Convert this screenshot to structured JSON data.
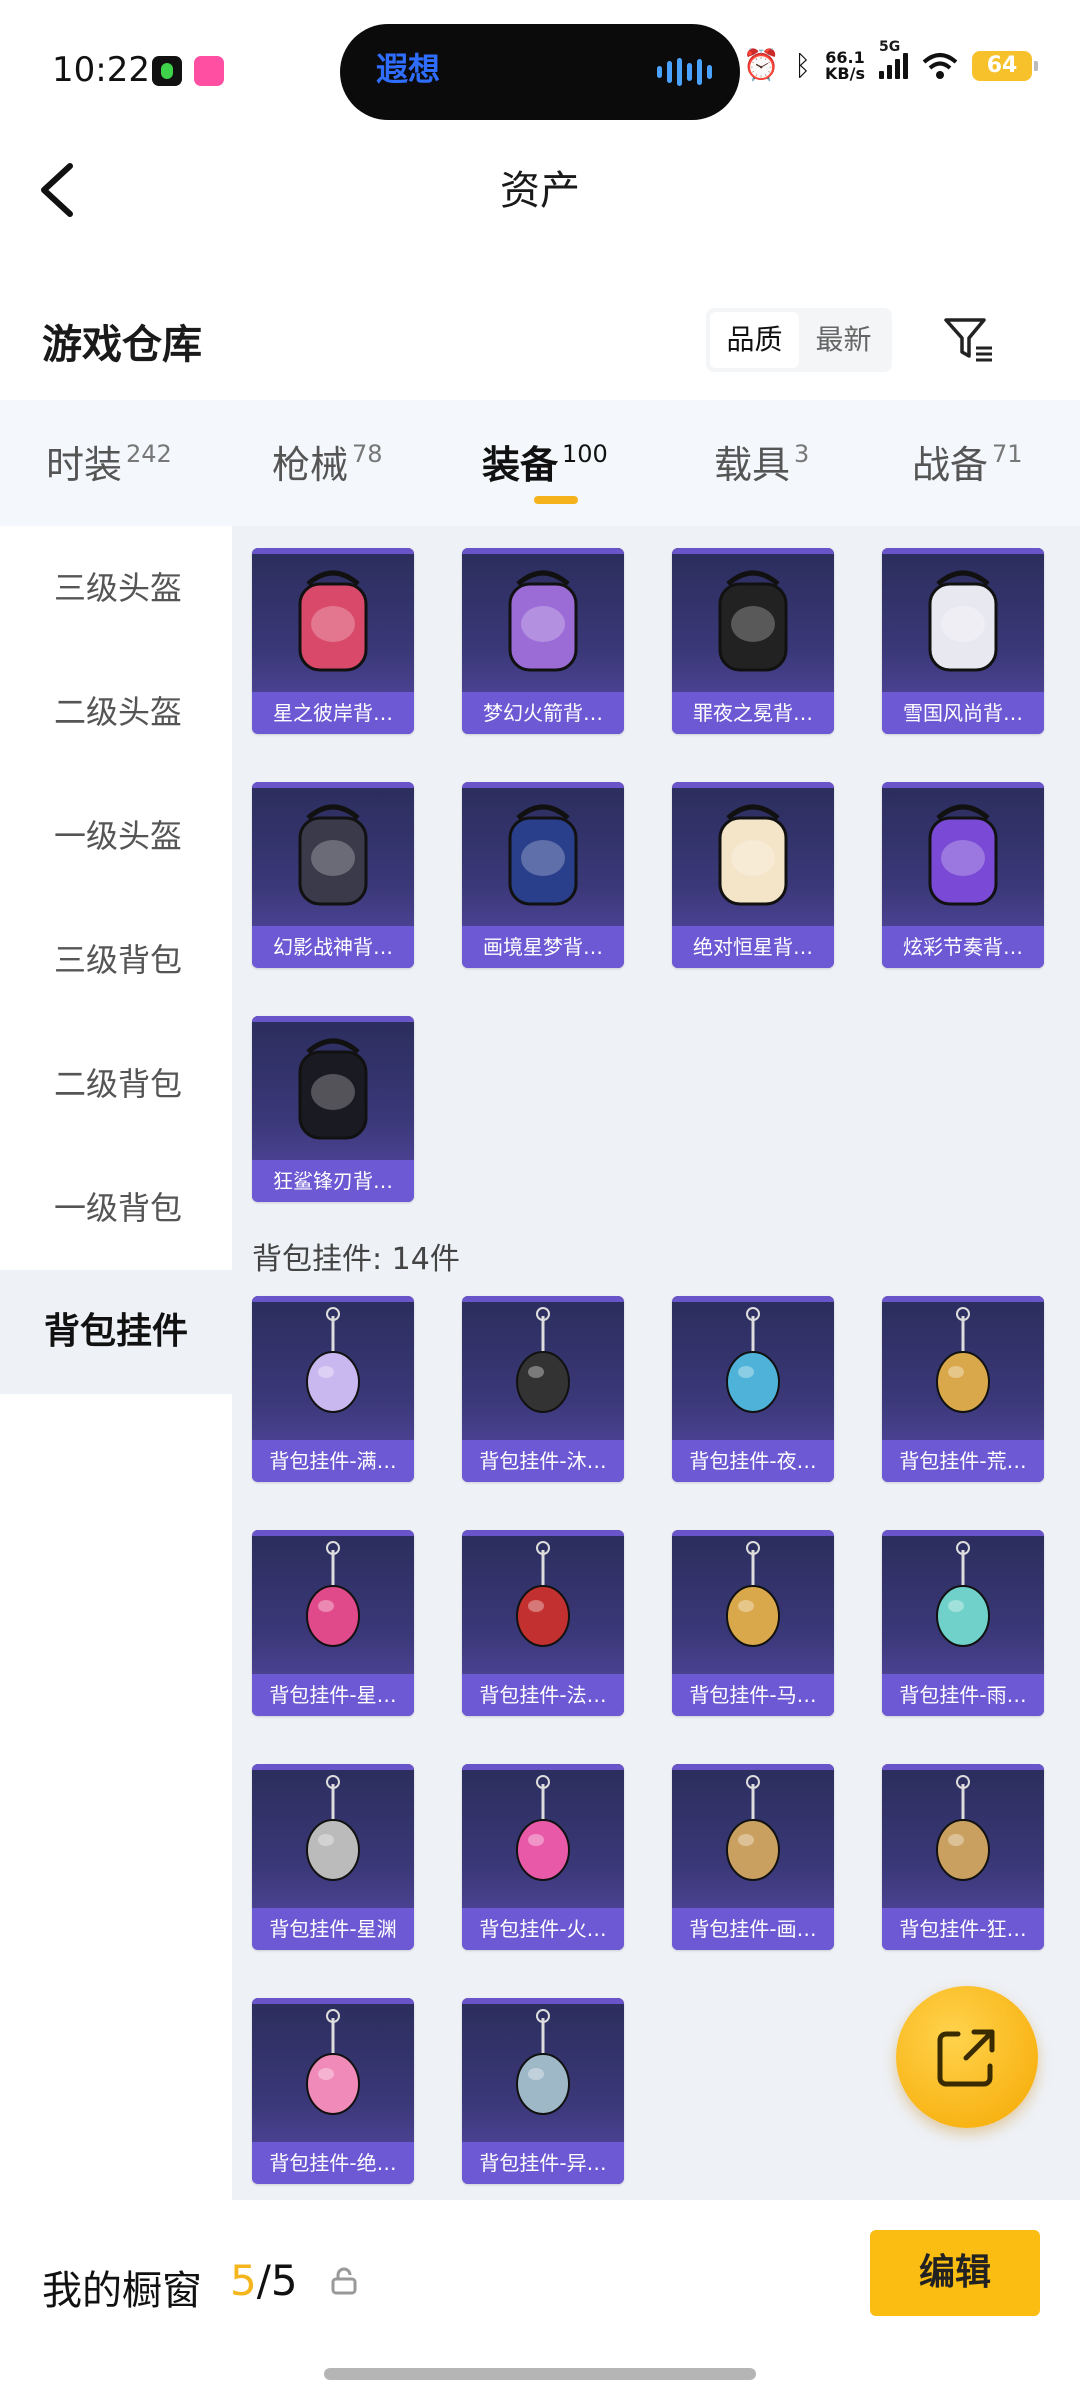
{
  "status_bar": {
    "time": "10:22",
    "island_text": "遐想",
    "net_speed_value": "66.1",
    "net_speed_unit": "KB/s",
    "network_type": "5G",
    "battery": "64"
  },
  "header": {
    "title": "资产"
  },
  "section": {
    "title": "游戏仓库",
    "sort_options": [
      "品质",
      "最新"
    ],
    "sort_selected": "品质"
  },
  "tabs": [
    {
      "label": "时装",
      "count": "242"
    },
    {
      "label": "枪械",
      "count": "78"
    },
    {
      "label": "装备",
      "count": "100",
      "active": true
    },
    {
      "label": "载具",
      "count": "3"
    },
    {
      "label": "战备",
      "count": "71"
    }
  ],
  "sidebar": {
    "items": [
      {
        "label": "三级头盔"
      },
      {
        "label": "二级头盔"
      },
      {
        "label": "一级头盔"
      },
      {
        "label": "三级背包"
      },
      {
        "label": "二级背包"
      },
      {
        "label": "一级背包"
      },
      {
        "label": "背包挂件",
        "active": true
      }
    ]
  },
  "backpacks": [
    {
      "label": "星之彼岸背…",
      "icon": "space-helmet-backpack-icon"
    },
    {
      "label": "梦幻火箭背…",
      "icon": "rocket-backpack-icon"
    },
    {
      "label": "罪夜之冕背…",
      "icon": "dark-crown-backpack-icon"
    },
    {
      "label": "雪国风尚背…",
      "icon": "snow-bunny-backpack-icon"
    },
    {
      "label": "幻影战神背…",
      "icon": "phantom-backpack-icon"
    },
    {
      "label": "画境星梦背…",
      "icon": "book-backpack-icon"
    },
    {
      "label": "绝对恒星背…",
      "icon": "popcorn-backpack-icon"
    },
    {
      "label": "炫彩节奏背…",
      "icon": "graffiti-backpack-icon"
    },
    {
      "label": "狂鲨锋刃背…",
      "icon": "shark-backpack-icon"
    }
  ],
  "charms_group": {
    "count_label": "背包挂件: 14件"
  },
  "charms": [
    {
      "label": "背包挂件-满…",
      "icon": "moon-charm-icon"
    },
    {
      "label": "背包挂件-沐…",
      "icon": "cat-charm-icon"
    },
    {
      "label": "背包挂件-夜…",
      "icon": "beetle-charm-icon"
    },
    {
      "label": "背包挂件-荒…",
      "icon": "octopus-charm-icon"
    },
    {
      "label": "背包挂件-星…",
      "icon": "planet-charm-icon"
    },
    {
      "label": "背包挂件-法…",
      "icon": "ferrari-keychain-icon"
    },
    {
      "label": "背包挂件-马…",
      "icon": "rocking-horse-charm-icon"
    },
    {
      "label": "背包挂件-雨…",
      "icon": "wand-charm-icon"
    },
    {
      "label": "背包挂件-星渊",
      "icon": "chain-charm-icon"
    },
    {
      "label": "背包挂件-火…",
      "icon": "pink-rocket-charm-icon"
    },
    {
      "label": "背包挂件-画…",
      "icon": "scroll-charm-icon"
    },
    {
      "label": "背包挂件-狂…",
      "icon": "fin-blade-charm-icon"
    },
    {
      "label": "背包挂件-绝…",
      "icon": "pink-speaker-charm-icon"
    },
    {
      "label": "背包挂件-异…",
      "icon": "dogtag-charm-icon"
    }
  ],
  "bottom_bar": {
    "showcase_label": "我的橱窗",
    "showcase_current": "5",
    "showcase_separator": "/",
    "showcase_total": "5",
    "edit_label": "编辑"
  },
  "colors": {
    "accent": "#fbbd12",
    "card_label_bg": "#6e59d4",
    "card_bg_top": "#2b2d5c",
    "card_bg_bottom": "#5a4aa8"
  }
}
